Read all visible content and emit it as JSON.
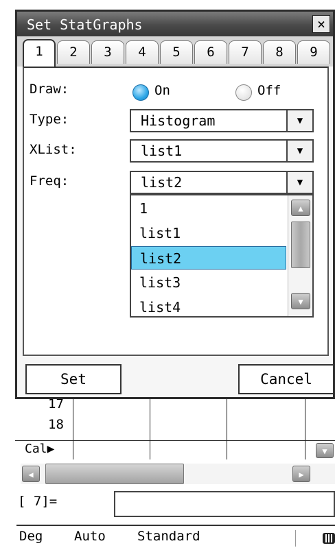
{
  "dialog": {
    "title": "Set StatGraphs",
    "close_icon": "×",
    "tabs": [
      "1",
      "2",
      "3",
      "4",
      "5",
      "6",
      "7",
      "8",
      "9"
    ],
    "active_tab": "1",
    "draw_label": "Draw:",
    "on_label": "On",
    "off_label": "Off",
    "type_label": "Type:",
    "type_value": "Histogram",
    "xlist_label": "XList:",
    "xlist_value": "list1",
    "freq_label": "Freq:",
    "freq_value": "list2",
    "dropdown_options": [
      "1",
      "list1",
      "list2",
      "list3",
      "list4"
    ],
    "selected_option": "list2",
    "set_button": "Set",
    "cancel_button": "Cancel",
    "combo_arrow": "▼",
    "scroll_up": "▲",
    "scroll_down": "▼"
  },
  "calc": {
    "row_17": "17",
    "row_18": "18",
    "cal_label": "Cal▶",
    "input_label": "[ 7]=",
    "scroll_left": "◀",
    "scroll_right": "▶",
    "down_icon": "▼"
  },
  "statusbar": {
    "angle": "Deg",
    "mode": "Auto",
    "format": "Standard"
  },
  "colors": {
    "accent": "#2ea6e6",
    "selected_row": "#6cd0f2",
    "titlebar": "#4a4a4a"
  }
}
